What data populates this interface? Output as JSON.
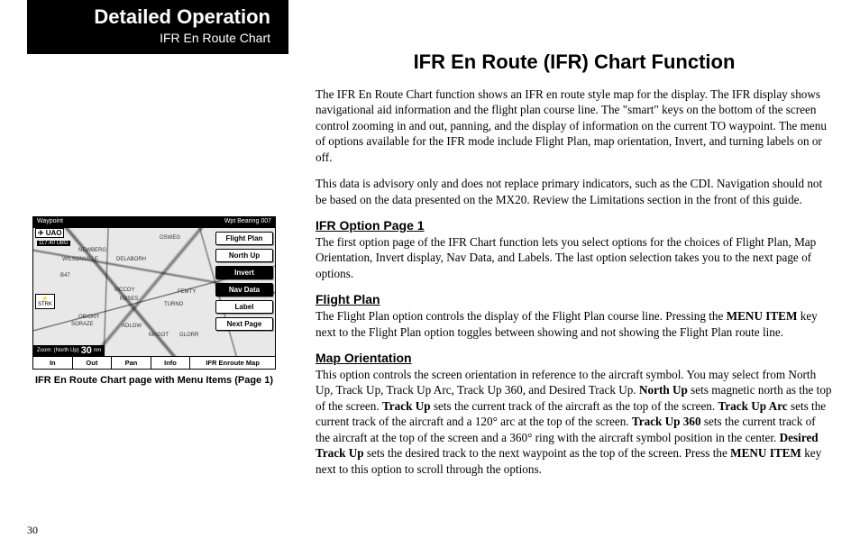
{
  "header": {
    "title": "Detailed Operation",
    "subtitle": "IFR En Route Chart"
  },
  "figure": {
    "top_left_label": "Waypoint",
    "top_right_label": "Wpt Bearing",
    "top_right_value": "007",
    "uao": "UAO",
    "freq_text": "117.40 UBG",
    "strk_icon": "⚡",
    "strk": "STRK",
    "labels": {
      "a": "NEWBERG",
      "b": "WILSONVILLE",
      "c": "OSWEG",
      "d": "DELABORH",
      "e": "B47",
      "f": "MCCOY",
      "g": "RBSES",
      "h": "TURNO",
      "i": "FEMTY",
      "j": "OBIONY",
      "k": "SORAZE",
      "l": "ADLOW",
      "m": "MAGOT",
      "n": "GLORR"
    },
    "menu": {
      "flight_plan": "Flight Plan",
      "north_up": "North Up",
      "invert": "Invert",
      "nav_data": "Nav Data",
      "label": "Label",
      "next_page": "Next Page"
    },
    "zoom_label": "Zoom: (North Up)",
    "zoom_value": "30",
    "zoom_unit": "nm",
    "softkeys": {
      "k1": "In",
      "k2": "Out",
      "k3": "Pan",
      "k4": "Info",
      "k5": "IFR Enroute Map"
    },
    "caption": "IFR En Route Chart page with Menu Items (Page 1)"
  },
  "main": {
    "title": "IFR En Route (IFR) Chart Function",
    "p1": "The IFR En Route Chart function shows an IFR en route style map for the display. The IFR display shows navigational aid information and the flight plan course line. The \"smart\" keys on the bottom of the screen control zooming in and out, panning, and the display of information on the current TO waypoint. The menu of options available for the IFR mode include Flight Plan, map orientation,  Invert, and turning labels on or off.",
    "p2": "This data is advisory only and does not replace primary indicators, such as the CDI. Navigation should not be based on the data presented on the MX20. Review the Limitations section in the front of this guide.",
    "s1_title": "IFR Option Page 1",
    "s1_body": "The first option page of the IFR Chart function lets you select options for the choices of Flight Plan, Map Orientation, Invert display, Nav Data, and Labels. The last option selection takes you to the next page of options.",
    "s2_title": "Flight Plan",
    "s2_pre": "The Flight Plan option controls the display of the Flight Plan course line. Pressing the ",
    "s2_bold": "MENU ITEM",
    "s2_post": " key next to the Flight Plan option toggles between showing and not showing the Flight Plan route line.",
    "s3_title": "Map Orientation",
    "s3_a": "This option controls the screen orientation in reference to the aircraft symbol. You may select from North Up, Track Up, Track Up Arc, Track Up 360, and Desired Track Up. ",
    "s3_b1": "North Up",
    "s3_c": " sets magnetic north as the top of the screen. ",
    "s3_b2": "Track Up ",
    "s3_d": " sets the current track of the aircraft as the top of the screen. ",
    "s3_b3": "Track Up Arc ",
    "s3_e": " sets the current track of the aircraft  and a 120° arc at the top of the screen. ",
    "s3_b4": "Track Up 360",
    "s3_f": " sets the current track of the aircraft at the top of the screen and a 360° ring with the aircraft symbol position in the center. ",
    "s3_b5": "Desired Track Up ",
    "s3_g": " sets the desired track to the next waypoint as the top of the screen. Press the ",
    "s3_b6": "MENU ITEM",
    "s3_h": " key next to this option to scroll through the options."
  },
  "page_number": "30"
}
